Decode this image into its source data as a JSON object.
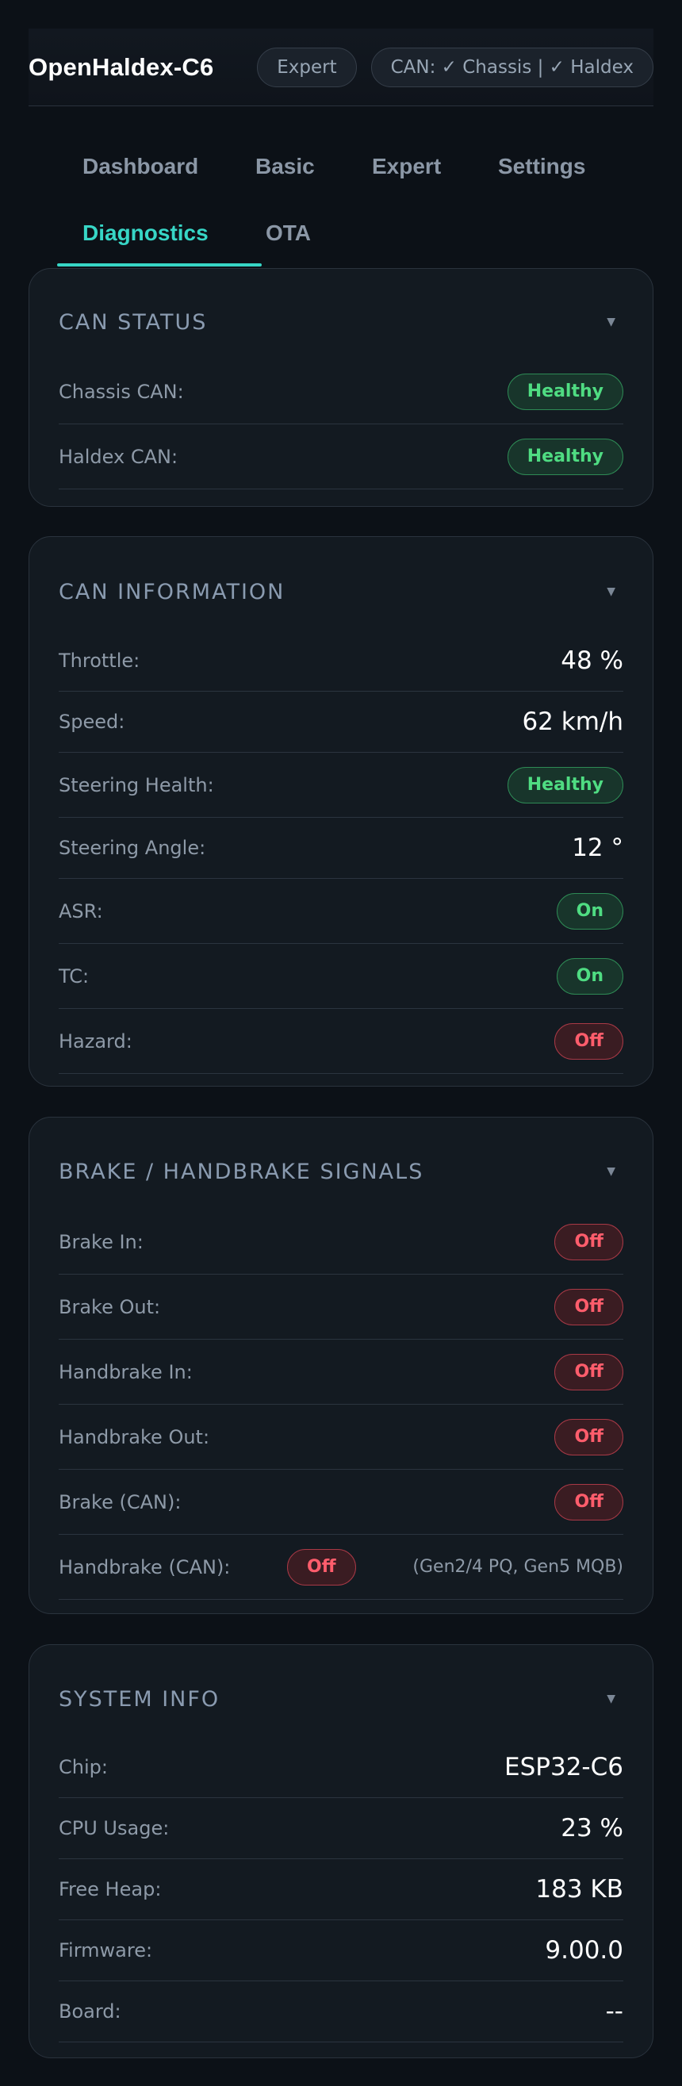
{
  "header": {
    "brand": "OpenHaldex-C6",
    "mode_pill": "Expert",
    "can_pill": "CAN: ✓ Chassis | ✓ Haldex"
  },
  "tabs": [
    {
      "label": "Dashboard",
      "active": false
    },
    {
      "label": "Basic",
      "active": false
    },
    {
      "label": "Expert",
      "active": false
    },
    {
      "label": "Settings",
      "active": false
    },
    {
      "label": "Diagnostics",
      "active": true
    },
    {
      "label": "OTA",
      "active": false
    }
  ],
  "can_status": {
    "title": "CAN STATUS",
    "rows": [
      {
        "label": "Chassis CAN:",
        "badge": "Healthy"
      },
      {
        "label": "Haldex CAN:",
        "badge": "Healthy"
      }
    ]
  },
  "can_information": {
    "title": "CAN INFORMATION",
    "rows": [
      {
        "label": "Throttle:",
        "value": "48 %"
      },
      {
        "label": "Speed:",
        "value": "62 km/h"
      },
      {
        "label": "Steering Health:",
        "badge": "Healthy"
      },
      {
        "label": "Steering Angle:",
        "value": "12 °"
      },
      {
        "label": "ASR:",
        "badge": "On"
      },
      {
        "label": "TC:",
        "badge": "On"
      },
      {
        "label": "Hazard:",
        "badge": "Off"
      }
    ]
  },
  "brake_signals": {
    "title": "BRAKE / HANDBRAKE SIGNALS",
    "rows": [
      {
        "label": "Brake In:",
        "badge": "Off"
      },
      {
        "label": "Brake Out:",
        "badge": "Off"
      },
      {
        "label": "Handbrake In:",
        "badge": "Off"
      },
      {
        "label": "Handbrake Out:",
        "badge": "Off"
      },
      {
        "label": "Brake (CAN):",
        "badge": "Off"
      },
      {
        "label": "Handbrake (CAN):",
        "badge": "Off",
        "note": "(Gen2/4 PQ, Gen5 MQB)"
      }
    ]
  },
  "system_info": {
    "title": "SYSTEM INFO",
    "rows": [
      {
        "label": "Chip:",
        "value": "ESP32-C6"
      },
      {
        "label": "CPU Usage:",
        "value": "23 %"
      },
      {
        "label": "Free Heap:",
        "value": "183 KB"
      },
      {
        "label": "Firmware:",
        "value": "9.00.0"
      },
      {
        "label": "Board:",
        "value": "--"
      }
    ]
  },
  "colors": {
    "accent": "#37d6c6",
    "healthy": "#4fdc82",
    "off": "#ff5d6c"
  },
  "icons": {
    "collapse": "chevron-down-icon"
  }
}
